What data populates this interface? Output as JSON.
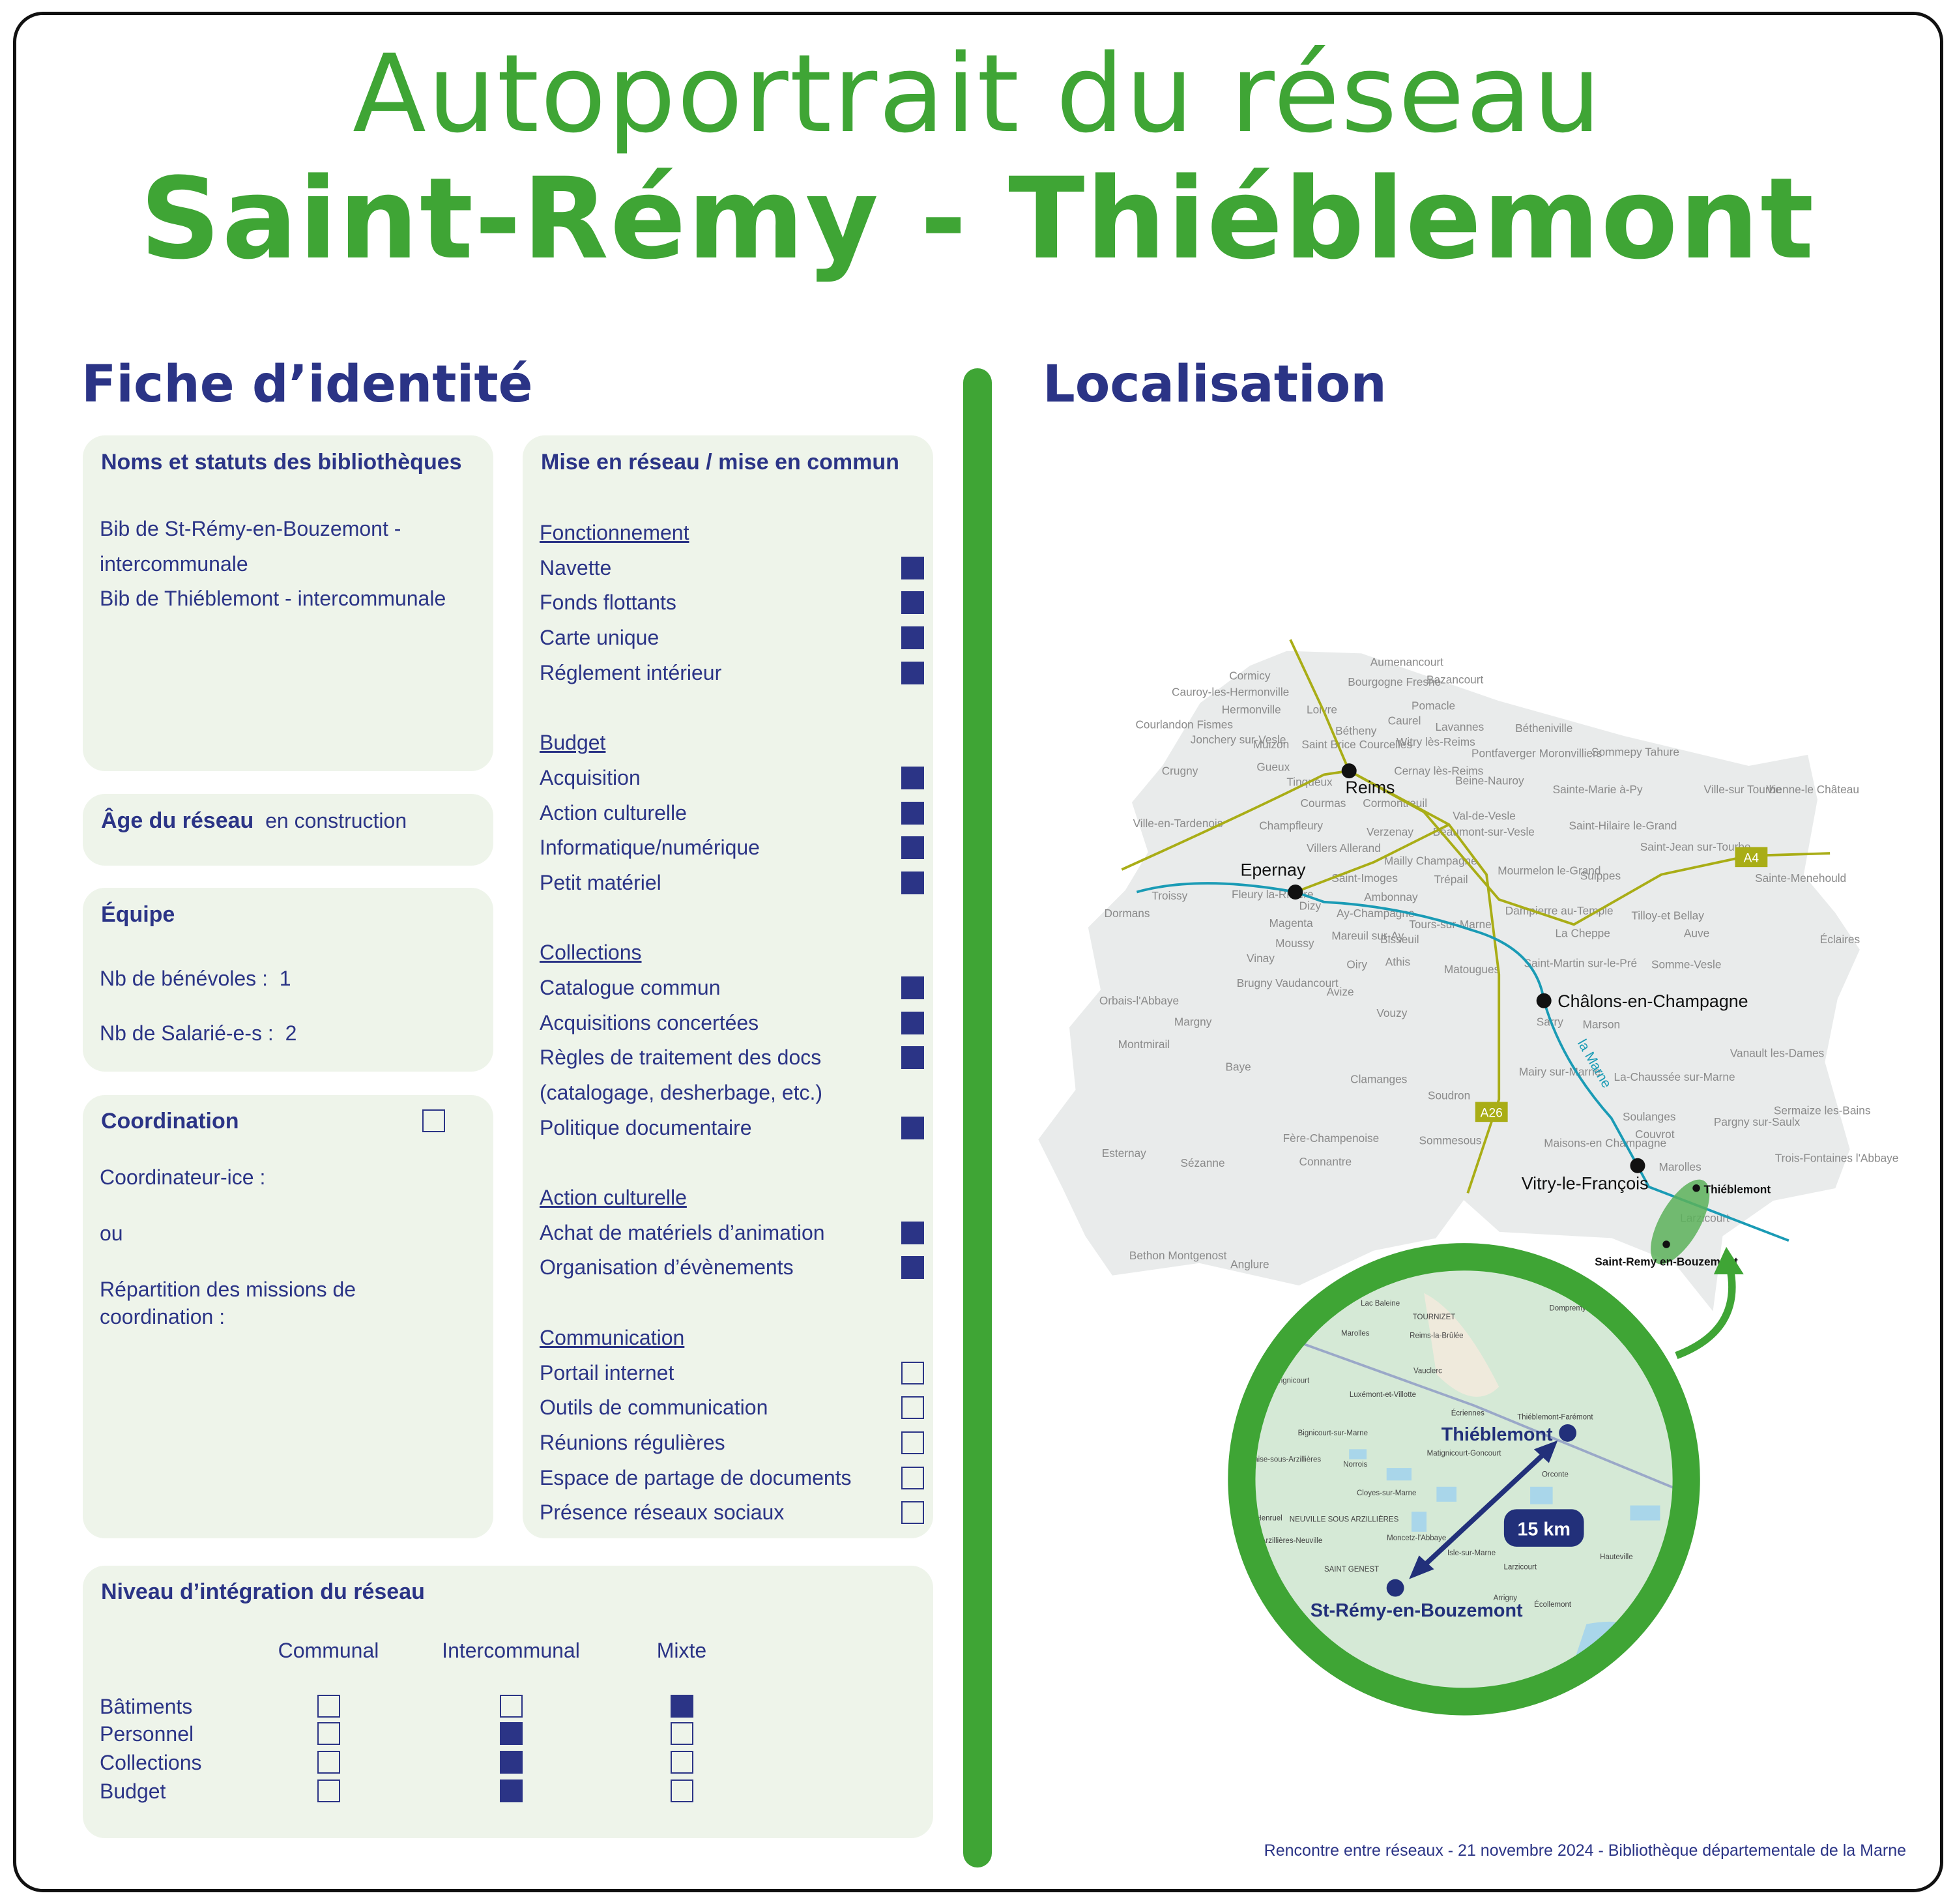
{
  "title": {
    "line1": "Autoportrait du réseau",
    "line2": "Saint-Rémy - Thiéblemont"
  },
  "colors": {
    "green": "#3fa535",
    "navy": "#2b3486",
    "card": "#eef4ea"
  },
  "fiche": {
    "heading": "Fiche d’identité",
    "noms": {
      "title": "Noms et statuts des bibliothèques",
      "lines": [
        "Bib de St-Rémy-en-Bouzemont -",
        "intercommunale",
        "Bib de Thiéblemont - intercommunale"
      ]
    },
    "age": {
      "label": "Âge du réseau",
      "value": "en construction"
    },
    "equipe": {
      "title": "Équipe",
      "benevoles_label": "Nb de bénévoles :",
      "benevoles": "1",
      "salaries_label": "Nb de Salarié-e-s :",
      "salaries": "2"
    },
    "coordination": {
      "title": "Coordination",
      "checked": false,
      "coordinateur": "Coordinateur-ice :",
      "ou": "ou",
      "repartition1": "Répartition des missions de",
      "repartition2": "coordination :"
    }
  },
  "mise_en_reseau": {
    "title": "Mise en réseau / mise en commun",
    "groups": [
      {
        "name": "Fonctionnement",
        "items": [
          {
            "label": "Navette",
            "checked": true
          },
          {
            "label": "Fonds flottants",
            "checked": true
          },
          {
            "label": "Carte unique",
            "checked": true
          },
          {
            "label": "Réglement intérieur",
            "checked": true
          }
        ]
      },
      {
        "name": "Budget ",
        "items": [
          {
            "label": "Acquisition",
            "checked": true
          },
          {
            "label": "Action culturelle",
            "checked": true
          },
          {
            "label": "Informatique/numérique",
            "checked": true
          },
          {
            "label": "Petit matériel",
            "checked": true
          }
        ]
      },
      {
        "name": "Collections",
        "items": [
          {
            "label": "Catalogue commun",
            "checked": true
          },
          {
            "label": "Acquisitions concertées",
            "checked": true
          },
          {
            "label": "Règles de traitement des docs",
            "checked": true
          },
          {
            "label": "(catalogage, desherbage, etc.)",
            "checked": null
          },
          {
            "label": "Politique documentaire",
            "checked": true
          }
        ]
      },
      {
        "name": "Action culturelle",
        "items": [
          {
            "label": "Achat de matériels d’animation",
            "checked": true
          },
          {
            "label": "Organisation d’évènements",
            "checked": true
          }
        ]
      },
      {
        "name": "Communication",
        "items": [
          {
            "label": "Portail internet",
            "checked": false
          },
          {
            "label": "Outils de communication",
            "checked": false
          },
          {
            "label": "Réunions régulières",
            "checked": false
          },
          {
            "label": "Espace de partage de documents",
            "checked": false
          },
          {
            "label": "Présence réseaux sociaux",
            "checked": false
          }
        ]
      }
    ]
  },
  "integration": {
    "title": "Niveau d’intégration du réseau",
    "columns": [
      "Communal",
      "Intercommunal",
      "Mixte"
    ],
    "rows": [
      {
        "label": "Bâtiments",
        "checked": [
          false,
          false,
          true
        ]
      },
      {
        "label": "Personnel",
        "checked": [
          false,
          true,
          false
        ]
      },
      {
        "label": "Collections",
        "checked": [
          false,
          true,
          false
        ]
      },
      {
        "label": "Budget",
        "checked": [
          false,
          true,
          false
        ]
      }
    ]
  },
  "localisation": {
    "heading": "Localisation",
    "cities": [
      "Reims",
      "Epernay",
      "Châlons-en-Champagne",
      "Vitry-le-François"
    ],
    "highlight": [
      "Thiéblemont",
      "Saint-Remy en-Bouzemont"
    ],
    "river": "la Marne",
    "roads": [
      "A4",
      "A26"
    ],
    "towns": [
      "Aumenancourt",
      "Cormicy",
      "Bourgogne Fresne",
      "Bazancourt",
      "Cauroy-les-Hermonville",
      "Hermonville",
      "Loivre",
      "Pomacle",
      "Courlandon Fismes",
      "Jonchery sur-Vesle",
      "Muizon",
      "Saint Brice Courcelles",
      "Bétheny",
      "Caurel",
      "Witry lès-Reims",
      "Lavannes",
      "Bétheniville",
      "Pontfaverger Moronvilliers",
      "Sommepy Tahure",
      "Crugny",
      "Gueux",
      "Tinqueux",
      "Cernay lès-Reims",
      "Beine-Nauroy",
      "Sainte-Marie à-Py",
      "Ville-sur Tourbe",
      "Vienne-le Château",
      "Courmas",
      "Cormontreuil",
      "Ville-en-Tardenois",
      "Champfleury",
      "Val-de-Vesle",
      "Saint-Hilaire le-Grand",
      "Verzenay",
      "Beaumont-sur-Vesle",
      "Villers Allerand",
      "Mailly Champagne",
      "Saint-Jean sur-Tourbe",
      "Mourmelon le-Grand",
      "Suippes",
      "Sainte-Menehould",
      "Saint-Imoges",
      "Trépail",
      "Troissy",
      "Fleury la-Rivière",
      "Ambonnay",
      "Dizy",
      "Dampierre au-Temple",
      "Tilloy-et Bellay",
      "Dormans",
      "Magenta",
      "Ay-Champagne",
      "Tours-sur-Marne",
      "La Cheppe",
      "Auve",
      "Mareuil sur-Ay",
      "Moussy",
      "Bisseuil",
      "Éclaires",
      "Vinay",
      "Oiry",
      "Athis",
      "Matougues",
      "Saint-Martin sur-le-Pré",
      "Somme-Vesle",
      "Brugny Vaudancourt",
      "Avize",
      "Orbais-l'Abbaye",
      "Vouzy",
      "Sarry",
      "Marson",
      "Margny",
      "Montmirail",
      "Vanault les-Dames",
      "Baye",
      "Mairy sur-Marne",
      "La-Chaussée sur-Marne",
      "Clamanges",
      "Soudron",
      "Sermaize les-Bains",
      "Soulanges",
      "Pargny sur-Saulx",
      "Esternay",
      "Sézanne",
      "Fère-Champenoise",
      "Connantre",
      "Sommesous",
      "Maisons-en Champagne",
      "Couvrot",
      "Trois-Fontaines l'Abbaye",
      "Marolles",
      "Larzicourt",
      "Bethon Montgenost",
      "Anglure"
    ],
    "inset": {
      "from": "Thiéblemont",
      "to": "St-Rémy-en-Bouzemont",
      "distance": "15 km",
      "places": [
        "Lac Baleine",
        "TOURNIZET",
        "Dompremy",
        "Marolles",
        "Reims-la-Brûlée",
        "Vauclerc",
        "Frignicourt",
        "Luxémont-et-Villotte",
        "Écriennes",
        "Thiéblemont-Farémont",
        "Bignicourt-sur-Marne",
        "Matignicourt-Goncourt",
        "Blaise-sous-Arzillières",
        "Norrois",
        "Orconte",
        "Cloyes-sur-Marne",
        "Henruel",
        "NEUVILLE SOUS ARZILLIÈRES",
        "Arzillières-Neuville",
        "Moncetz-l'Abbaye",
        "Isle-sur-Marne",
        "Hauteville",
        "SAINT GENEST",
        "Larzicourt",
        "Arrigny",
        "Écollemont"
      ]
    }
  },
  "footer": "Rencontre entre réseaux - 21 novembre 2024 - Bibliothèque départementale de la Marne"
}
